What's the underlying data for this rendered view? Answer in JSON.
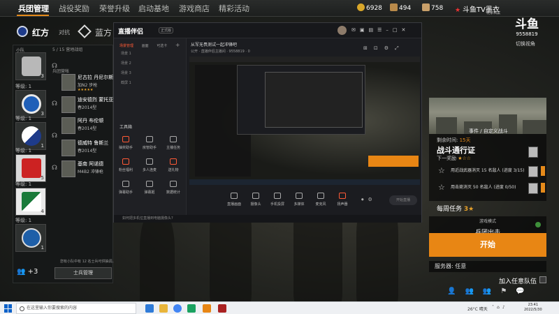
{
  "topnav": {
    "items": [
      "兵团管理",
      "战役奖励",
      "荣誉升级",
      "启动基地",
      "游戏商店",
      "精彩活动"
    ],
    "resources": [
      {
        "icon": "coin-icon",
        "value": "6928"
      },
      {
        "icon": "card-icon",
        "value": "494"
      },
      {
        "icon": "ticket-icon",
        "value": "758"
      }
    ],
    "username": "斗鱼TV墨衣",
    "user_sub": "玩家档案"
  },
  "teams": {
    "red": "红方",
    "vs": "对抗",
    "blue": "蓝方"
  },
  "left": {
    "header_small": "小队",
    "list_header": "5 / 15  营地战组",
    "group_label": "兵团营帐",
    "slots": [
      {
        "level": "",
        "num": "3"
      },
      {
        "level": "等级: 1",
        "num": "3"
      },
      {
        "level": "等级: 1",
        "num": "1"
      },
      {
        "level": "等级: 1",
        "num": "5"
      },
      {
        "level": "等级: 1",
        "num": "4"
      },
      {
        "level": "等级: 1",
        "num": "1"
      }
    ],
    "members": [
      {
        "name": "尼古拉 丹尼尔斯",
        "sub": "加N2 步枪",
        "stars": "★★★★★"
      },
      {
        "name": "迪安德烈 蒙托亚",
        "sub": "春2014型",
        "stars": ""
      },
      {
        "name": "阿丹 布伦顿",
        "sub": "春2014型",
        "stars": ""
      },
      {
        "name": "德威特 鲁斯兰",
        "sub": "春2014型",
        "stars": ""
      },
      {
        "name": "基南 阿诺德",
        "sub": "M4B2 冲锋枪",
        "stars": ""
      }
    ],
    "invite_hint": "您有小队中有 12 名士兵可供抽调。",
    "plus": "+3",
    "manage_button": "士兵管理"
  },
  "stream": {
    "app_name": "直播伴侣",
    "version": "正式版",
    "side_tabs": [
      "场景管理",
      "画面",
      "可选卡"
    ],
    "scenes": [
      "场景 1",
      "场景 2",
      "场景 3",
      "截屏 1"
    ],
    "tools_label": "工具箱",
    "tools": [
      {
        "label": "抽奖助手",
        "hot": true
      },
      {
        "label": "房管助手",
        "hot": false
      },
      {
        "label": "主播任务",
        "hot": false
      },
      {
        "label": "粉丝福利",
        "hot": true
      },
      {
        "label": "多人连麦",
        "hot": false
      },
      {
        "label": "送礼物",
        "hot": true
      },
      {
        "label": "弹幕助手",
        "hot": false
      },
      {
        "label": "弹幕姬",
        "hot": false
      },
      {
        "label": "数据统计",
        "hot": false
      }
    ],
    "room_title": "从军无畏测试一起冲锋吧",
    "room_sub": "公开  · 直播伴侣主播间 · 9558819 · 0",
    "bottom_tools": [
      "直播画面",
      "摄像头",
      "手机投屏",
      "多媒体",
      "麦克风",
      "扬声器"
    ],
    "go_live": "开始直播",
    "status_text": "如何把多机位直播到电脑摄像头?"
  },
  "right": {
    "logo": "斗鱼",
    "logo_id": "9558819",
    "logo_sub": "切换视角",
    "timer_label": "剩余时间:",
    "timer_value": "15天",
    "event_tag": "事件 / 自定义战斗",
    "pass_title": "战斗通行证",
    "next_reward_label": "下一奖励",
    "next_reward_stars": "★☆☆",
    "tasks": [
      {
        "text": "用近战武器消灭 15 名敌人 (进度 3/15)"
      },
      {
        "text": "用击毙消灭 50 名敌人 (进度 0/50)"
      }
    ],
    "weekly_label": "每周任务",
    "weekly_count": "3",
    "mode_label": "游戏模式",
    "mode_value": "兵团出击",
    "start_button": "开始",
    "server_label": "服务器: 任意",
    "join_label": "加入任意队伍"
  },
  "taskbar": {
    "search_placeholder": "在这里输入你要搜索的内容",
    "weather": "26°C 晴天",
    "time": "23:41",
    "date": "2022/5/30"
  },
  "colors": {
    "accent": "#e88614",
    "brand_red": "#ff5a36",
    "team_blue": "#1e3b8a"
  }
}
